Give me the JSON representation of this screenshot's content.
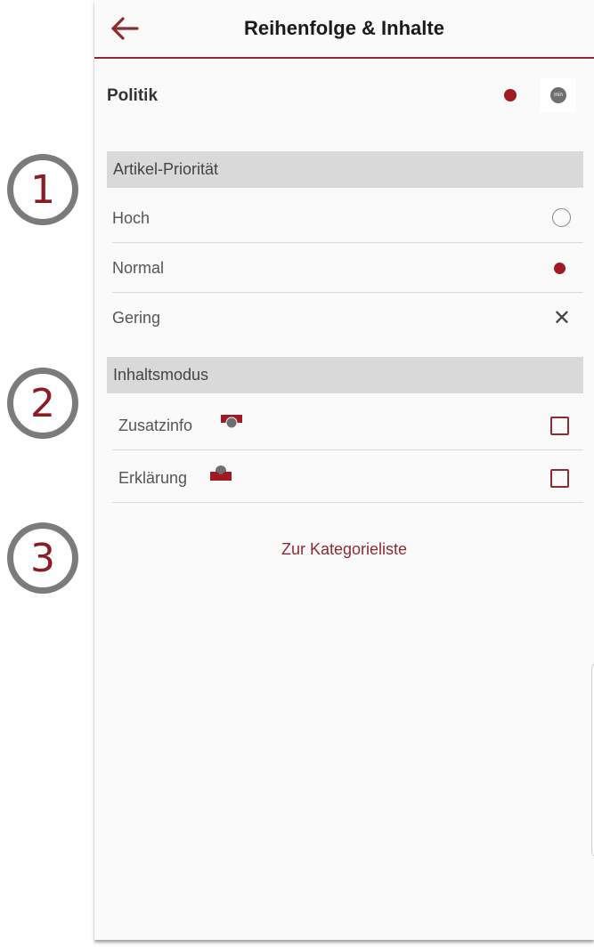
{
  "callouts": [
    "1",
    "2",
    "3"
  ],
  "appbar": {
    "title": "Reihenfolge & Inhalte",
    "back_icon": "arrow-left-icon",
    "accent": "#8e2a30"
  },
  "category": {
    "name": "Politik",
    "dot_color": "#a01a22",
    "badge_label": "min"
  },
  "priority": {
    "header": "Artikel-Priorität",
    "options": [
      {
        "label": "Hoch",
        "state": "unselected"
      },
      {
        "label": "Normal",
        "state": "selected"
      },
      {
        "label": "Gering",
        "state": "excluded"
      }
    ]
  },
  "content_mode": {
    "header": "Inhaltsmodus",
    "options": [
      {
        "label": "Zusatzinfo",
        "checked": false,
        "icon": "zusatzinfo-icon"
      },
      {
        "label": "Erklärung",
        "checked": false,
        "icon": "erklaerung-icon"
      }
    ]
  },
  "link": {
    "label": "Zur Kategorieliste"
  }
}
